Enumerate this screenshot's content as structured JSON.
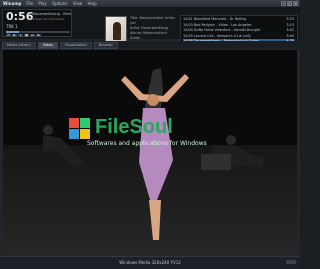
{
  "window": {
    "app_name": "Winamp",
    "menu": [
      "File",
      "Play",
      "Options",
      "View",
      "Help"
    ]
  },
  "player": {
    "time": "0:56",
    "now_playing": "2 Dauerwehklang - Melancholisch Schön (4:35)",
    "info": "128 kbps  44 kHz  stereo",
    "track_label": "TRK 1",
    "progress": 0.2
  },
  "album": {
    "title_line": "Title: Melancholisch Schön (ori",
    "artist_line": "Artist: Dauerwehklang",
    "album_line": "Album: Melancholisch Schön"
  },
  "playlist": [
    {
      "label": "10/01 Blackfield Mermaid - Dr Rolling",
      "duration": "3:23"
    },
    {
      "label": "10/03 Bad Religion - Video - Los Angeles",
      "duration": "3:15"
    },
    {
      "label": "10/04 Dufte Farbe Valentine - Handel Brought",
      "duration": "3:42"
    },
    {
      "label": "10/05 Lacuna Coil - Heaven's A Lie (vid)",
      "duration": "3:40"
    },
    {
      "label": "10/08 Dauerwehklang - Melancholisch Schön",
      "duration": "4:35",
      "selected": true
    }
  ],
  "tabs": [
    "Media Library",
    "Video",
    "Visualization",
    "Browser"
  ],
  "video": {
    "watermark_text": "FileSoul",
    "watermark_sub": "Softwares and applications for Windows"
  },
  "status": {
    "format_text": "Windows Media  320x240  YV12"
  },
  "colors": {
    "accent": "#29a85f",
    "selection": "#2d5c8a"
  }
}
